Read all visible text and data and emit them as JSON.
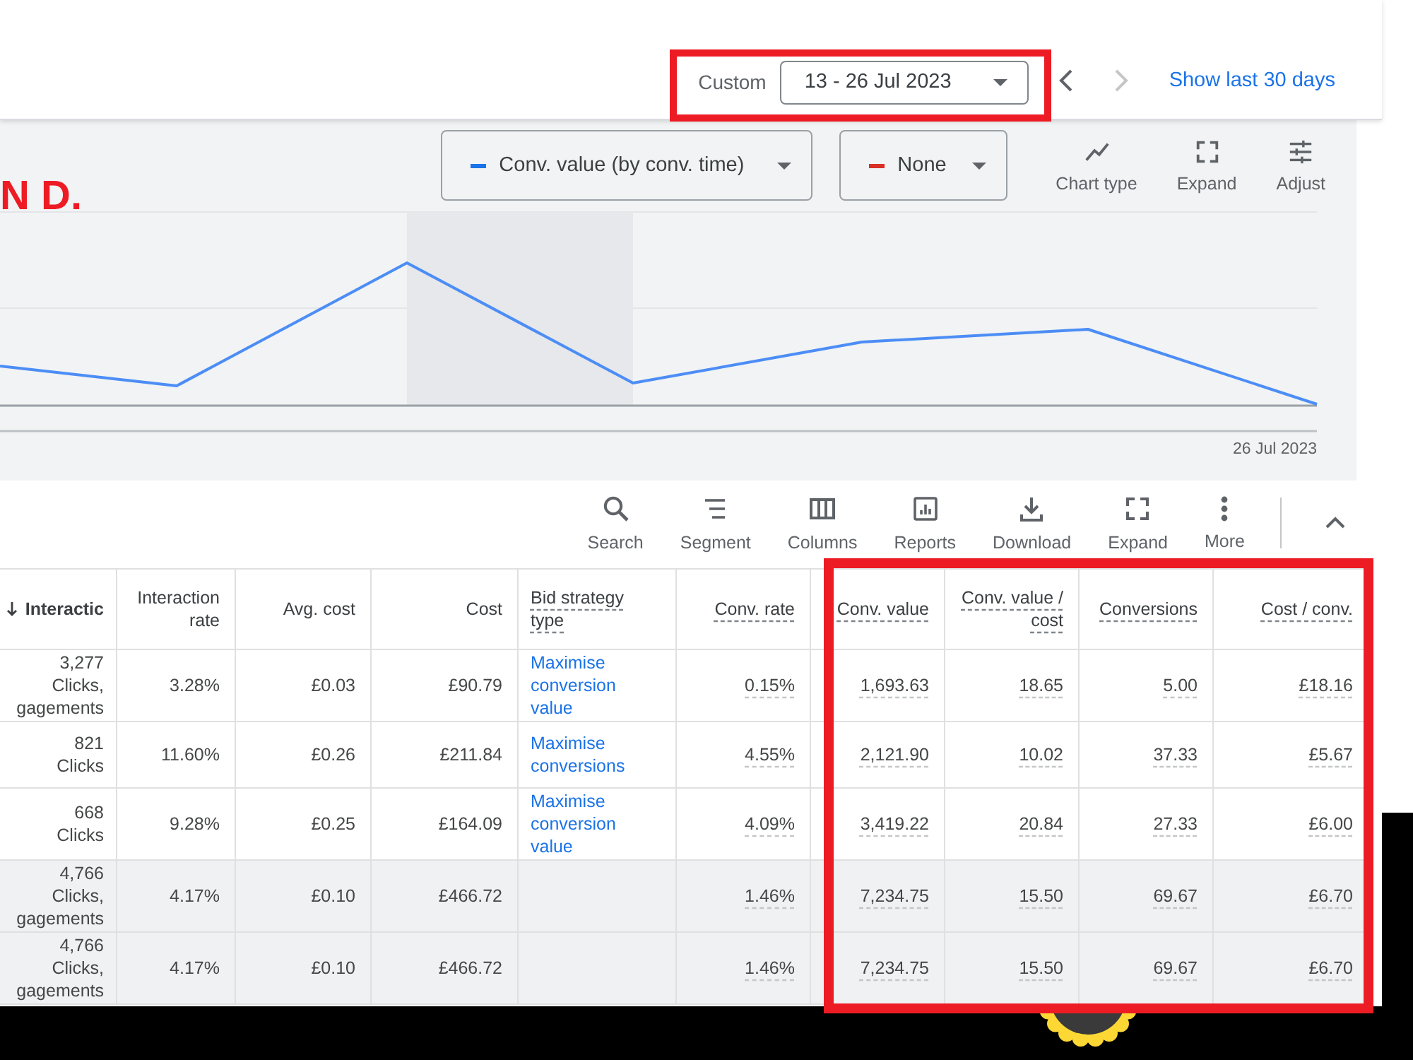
{
  "top_bar": {
    "date_range": {
      "label": "Custom",
      "value": "13 - 26 Jul 2023",
      "highlighted": true
    },
    "nav_buttons": [
      {
        "kind": "prev",
        "disabled": false
      },
      {
        "kind": "next",
        "disabled": true
      }
    ],
    "link": "Show last 30 days"
  },
  "chart_panel": {
    "caption": "N D.",
    "metrics": [
      {
        "label": "Conv. value (by conv. time)",
        "color": "#1a73e8"
      },
      {
        "label": "None",
        "color": "#d93025"
      }
    ],
    "tools": [
      {
        "label": "Chart type",
        "kind": "chart_type"
      },
      {
        "label": "Expand",
        "kind": "expand"
      },
      {
        "label": "Adjust",
        "kind": "adjust"
      }
    ],
    "end_date": "26 Jul 2023"
  },
  "table_toolbar": {
    "buttons": [
      {
        "label": "Search",
        "kind": "search"
      },
      {
        "label": "Segment",
        "kind": "segment"
      },
      {
        "label": "Columns",
        "kind": "columns"
      },
      {
        "label": "Reports",
        "kind": "reports"
      },
      {
        "label": "Download",
        "kind": "download"
      },
      {
        "label": "Expand",
        "kind": "expand"
      },
      {
        "label": "More",
        "kind": "more"
      }
    ],
    "collapse": {
      "expanded": true
    }
  },
  "table": {
    "columns": [
      {
        "label": "Interactic",
        "kind": "text",
        "sorted": true,
        "underlined": false,
        "highlighted": false
      },
      {
        "label": "Interaction rate",
        "kind": "metric",
        "sorted": false,
        "underlined": false,
        "highlighted": false
      },
      {
        "label": "Avg. cost",
        "kind": "metric",
        "sorted": false,
        "underlined": false,
        "highlighted": false
      },
      {
        "label": "Cost",
        "kind": "metric",
        "sorted": false,
        "underlined": false,
        "highlighted": false
      },
      {
        "label": "Bid strategy type",
        "kind": "link",
        "sorted": false,
        "underlined": true,
        "highlighted": false
      },
      {
        "label": "Conv. rate",
        "kind": "metric",
        "sorted": false,
        "underlined": true,
        "highlighted": false
      },
      {
        "label": "Conv. value",
        "kind": "metric",
        "sorted": false,
        "underlined": true,
        "highlighted": true
      },
      {
        "label": "Conv. value / cost",
        "kind": "metric",
        "sorted": false,
        "underlined": true,
        "highlighted": true
      },
      {
        "label": "Conversions",
        "kind": "metric",
        "sorted": false,
        "underlined": true,
        "highlighted": true
      },
      {
        "label": "Cost / conv.",
        "kind": "metric",
        "sorted": false,
        "underlined": true,
        "highlighted": true
      }
    ],
    "rows": [
      {
        "total": false,
        "cells": [
          "3,277\nClicks,\ngagements",
          "3.28%",
          "£0.03",
          "£90.79",
          "Maximise conversion value",
          "0.15%",
          "1,693.63",
          "18.65",
          "5.00",
          "£18.16"
        ]
      },
      {
        "total": false,
        "cells": [
          "821\nClicks",
          "11.60%",
          "£0.26",
          "£211.84",
          "Maximise conversions",
          "4.55%",
          "2,121.90",
          "10.02",
          "37.33",
          "£5.67"
        ]
      },
      {
        "total": false,
        "cells": [
          "668\nClicks",
          "9.28%",
          "£0.25",
          "£164.09",
          "Maximise conversion value",
          "4.09%",
          "3,419.22",
          "20.84",
          "27.33",
          "£6.00"
        ]
      },
      {
        "total": true,
        "cells": [
          "4,766\nClicks,\ngagements",
          "4.17%",
          "£0.10",
          "£466.72",
          null,
          "1.46%",
          "7,234.75",
          "15.50",
          "69.67",
          "£6.70"
        ]
      },
      {
        "total": true,
        "cells": [
          "4,766\nClicks,\ngagements",
          "4.17%",
          "£0.10",
          "£466.72",
          null,
          "1.46%",
          "7,234.75",
          "15.50",
          "69.67",
          "£6.70"
        ]
      }
    ]
  }
}
